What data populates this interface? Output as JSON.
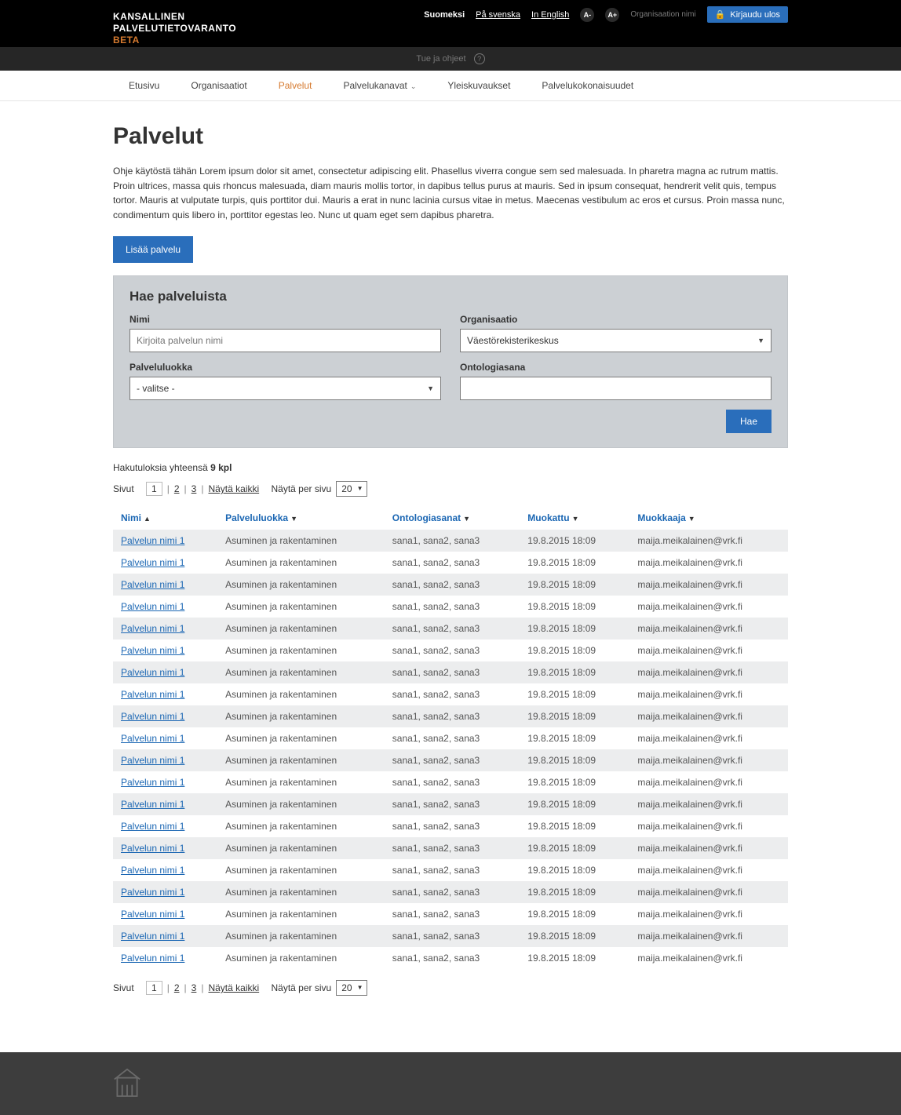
{
  "header": {
    "logo_line1": "KANSALLINEN",
    "logo_line2": "PALVELUTIETOVARANTO",
    "logo_beta": "BETA",
    "languages": [
      {
        "label": "Suomeksi",
        "active": true
      },
      {
        "label": "På svenska",
        "active": false
      },
      {
        "label": "In English",
        "active": false
      }
    ],
    "font_minus": "A-",
    "font_plus": "A+",
    "organization_name": "Organisaation nimi",
    "logout_label": "Kirjaudu ulos",
    "subbar_label": "Tue ja ohjeet",
    "subbar_icon": "?"
  },
  "nav": [
    {
      "label": "Etusivu",
      "active": false,
      "dropdown": false
    },
    {
      "label": "Organisaatiot",
      "active": false,
      "dropdown": false
    },
    {
      "label": "Palvelut",
      "active": true,
      "dropdown": false
    },
    {
      "label": "Palvelukanavat",
      "active": false,
      "dropdown": true
    },
    {
      "label": "Yleiskuvaukset",
      "active": false,
      "dropdown": false
    },
    {
      "label": "Palvelukokonaisuudet",
      "active": false,
      "dropdown": false
    }
  ],
  "page": {
    "title": "Palvelut",
    "intro": "Ohje käytöstä tähän Lorem ipsum dolor sit amet, consectetur adipiscing elit. Phasellus viverra congue sem sed malesuada. In pharetra magna ac rutrum mattis. Proin ultrices, massa quis rhoncus malesuada, diam mauris mollis tortor, in dapibus tellus purus at mauris. Sed in ipsum consequat, hendrerit velit quis, tempus tortor. Mauris at vulputate turpis, quis porttitor dui. Mauris a erat in nunc lacinia cursus vitae in metus. Maecenas vestibulum ac eros et cursus. Proin massa nunc, condimentum quis libero in, porttitor egestas leo. Nunc ut quam eget sem dapibus pharetra.",
    "add_button": "Lisää palvelu"
  },
  "search": {
    "panel_title": "Hae palveluista",
    "name_label": "Nimi",
    "name_placeholder": "Kirjoita palvelun nimi",
    "org_label": "Organisaatio",
    "org_value": "Väestörekisterikeskus",
    "class_label": "Palveluluokka",
    "class_value": "- valitse -",
    "ontology_label": "Ontologiasana",
    "search_button": "Hae"
  },
  "results": {
    "total_label": "Hakutuloksia yhteensä",
    "total_value": "9 kpl",
    "pager_pages_label": "Sivut",
    "pages": [
      "1",
      "2",
      "3"
    ],
    "current_page": "1",
    "show_all": "Näytä kaikki",
    "per_page_label": "Näytä per sivu",
    "per_page_value": "20",
    "columns": [
      {
        "label": "Nimi",
        "sort": "asc"
      },
      {
        "label": "Palveluluokka",
        "sort": "desc"
      },
      {
        "label": "Ontologiasanat",
        "sort": "desc"
      },
      {
        "label": "Muokattu",
        "sort": "desc"
      },
      {
        "label": "Muokkaaja",
        "sort": "desc"
      }
    ],
    "row_template": {
      "name": "Palvelun nimi 1",
      "class": "Asuminen ja rakentaminen",
      "ontology": "sana1, sana2, sana3",
      "modified": "19.8.2015 18:09",
      "editor": "maija.meikalainen@vrk.fi"
    },
    "row_count": 20
  }
}
